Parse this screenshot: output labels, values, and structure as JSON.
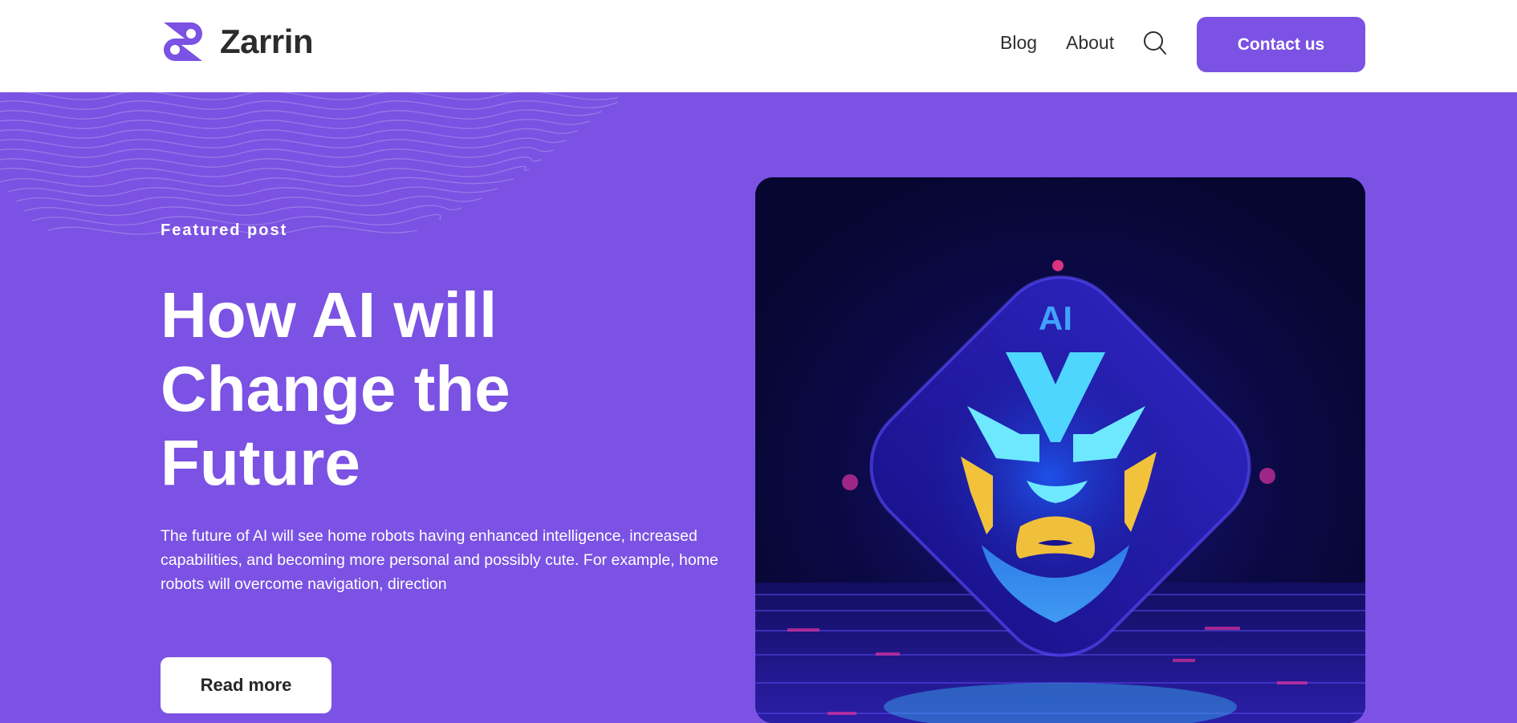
{
  "brand": {
    "name": "Zarrin",
    "logo_icon": "zarrin-logo-icon"
  },
  "nav": {
    "links": [
      {
        "label": "Blog"
      },
      {
        "label": "About"
      }
    ],
    "search_icon": "search-icon",
    "cta_label": "Contact us"
  },
  "hero": {
    "eyebrow": "Featured post",
    "title": "How AI will Change the Future",
    "excerpt": "The future of AI will see home robots having enhanced intelligence, increased capabilities, and becoming more personal and possibly cute. For example, home robots will overcome navigation, direction",
    "read_more_label": "Read more",
    "image": {
      "badge_text": "AI"
    }
  },
  "colors": {
    "brand_purple": "#7b52e3",
    "header_bg": "#ffffff",
    "text_dark": "#2c2c2c",
    "card_bg": "#0a0838"
  }
}
